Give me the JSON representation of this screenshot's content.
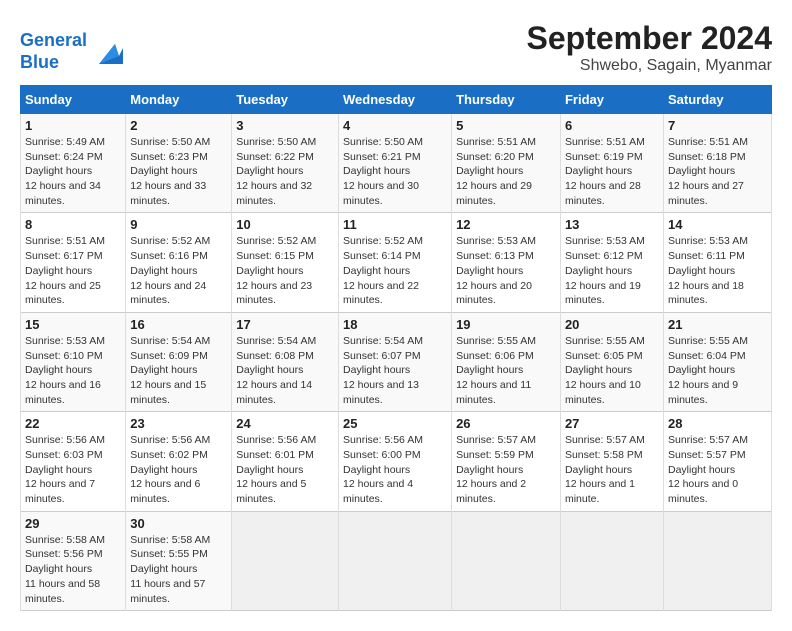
{
  "header": {
    "logo_line1": "General",
    "logo_line2": "Blue",
    "month": "September 2024",
    "location": "Shwebo, Sagain, Myanmar"
  },
  "days_of_week": [
    "Sunday",
    "Monday",
    "Tuesday",
    "Wednesday",
    "Thursday",
    "Friday",
    "Saturday"
  ],
  "weeks": [
    [
      {
        "day": "1",
        "sunrise": "5:49 AM",
        "sunset": "6:24 PM",
        "daylight": "12 hours and 34 minutes."
      },
      {
        "day": "2",
        "sunrise": "5:50 AM",
        "sunset": "6:23 PM",
        "daylight": "12 hours and 33 minutes."
      },
      {
        "day": "3",
        "sunrise": "5:50 AM",
        "sunset": "6:22 PM",
        "daylight": "12 hours and 32 minutes."
      },
      {
        "day": "4",
        "sunrise": "5:50 AM",
        "sunset": "6:21 PM",
        "daylight": "12 hours and 30 minutes."
      },
      {
        "day": "5",
        "sunrise": "5:51 AM",
        "sunset": "6:20 PM",
        "daylight": "12 hours and 29 minutes."
      },
      {
        "day": "6",
        "sunrise": "5:51 AM",
        "sunset": "6:19 PM",
        "daylight": "12 hours and 28 minutes."
      },
      {
        "day": "7",
        "sunrise": "5:51 AM",
        "sunset": "6:18 PM",
        "daylight": "12 hours and 27 minutes."
      }
    ],
    [
      {
        "day": "8",
        "sunrise": "5:51 AM",
        "sunset": "6:17 PM",
        "daylight": "12 hours and 25 minutes."
      },
      {
        "day": "9",
        "sunrise": "5:52 AM",
        "sunset": "6:16 PM",
        "daylight": "12 hours and 24 minutes."
      },
      {
        "day": "10",
        "sunrise": "5:52 AM",
        "sunset": "6:15 PM",
        "daylight": "12 hours and 23 minutes."
      },
      {
        "day": "11",
        "sunrise": "5:52 AM",
        "sunset": "6:14 PM",
        "daylight": "12 hours and 22 minutes."
      },
      {
        "day": "12",
        "sunrise": "5:53 AM",
        "sunset": "6:13 PM",
        "daylight": "12 hours and 20 minutes."
      },
      {
        "day": "13",
        "sunrise": "5:53 AM",
        "sunset": "6:12 PM",
        "daylight": "12 hours and 19 minutes."
      },
      {
        "day": "14",
        "sunrise": "5:53 AM",
        "sunset": "6:11 PM",
        "daylight": "12 hours and 18 minutes."
      }
    ],
    [
      {
        "day": "15",
        "sunrise": "5:53 AM",
        "sunset": "6:10 PM",
        "daylight": "12 hours and 16 minutes."
      },
      {
        "day": "16",
        "sunrise": "5:54 AM",
        "sunset": "6:09 PM",
        "daylight": "12 hours and 15 minutes."
      },
      {
        "day": "17",
        "sunrise": "5:54 AM",
        "sunset": "6:08 PM",
        "daylight": "12 hours and 14 minutes."
      },
      {
        "day": "18",
        "sunrise": "5:54 AM",
        "sunset": "6:07 PM",
        "daylight": "12 hours and 13 minutes."
      },
      {
        "day": "19",
        "sunrise": "5:55 AM",
        "sunset": "6:06 PM",
        "daylight": "12 hours and 11 minutes."
      },
      {
        "day": "20",
        "sunrise": "5:55 AM",
        "sunset": "6:05 PM",
        "daylight": "12 hours and 10 minutes."
      },
      {
        "day": "21",
        "sunrise": "5:55 AM",
        "sunset": "6:04 PM",
        "daylight": "12 hours and 9 minutes."
      }
    ],
    [
      {
        "day": "22",
        "sunrise": "5:56 AM",
        "sunset": "6:03 PM",
        "daylight": "12 hours and 7 minutes."
      },
      {
        "day": "23",
        "sunrise": "5:56 AM",
        "sunset": "6:02 PM",
        "daylight": "12 hours and 6 minutes."
      },
      {
        "day": "24",
        "sunrise": "5:56 AM",
        "sunset": "6:01 PM",
        "daylight": "12 hours and 5 minutes."
      },
      {
        "day": "25",
        "sunrise": "5:56 AM",
        "sunset": "6:00 PM",
        "daylight": "12 hours and 4 minutes."
      },
      {
        "day": "26",
        "sunrise": "5:57 AM",
        "sunset": "5:59 PM",
        "daylight": "12 hours and 2 minutes."
      },
      {
        "day": "27",
        "sunrise": "5:57 AM",
        "sunset": "5:58 PM",
        "daylight": "12 hours and 1 minute."
      },
      {
        "day": "28",
        "sunrise": "5:57 AM",
        "sunset": "5:57 PM",
        "daylight": "12 hours and 0 minutes."
      }
    ],
    [
      {
        "day": "29",
        "sunrise": "5:58 AM",
        "sunset": "5:56 PM",
        "daylight": "11 hours and 58 minutes."
      },
      {
        "day": "30",
        "sunrise": "5:58 AM",
        "sunset": "5:55 PM",
        "daylight": "11 hours and 57 minutes."
      },
      null,
      null,
      null,
      null,
      null
    ]
  ]
}
